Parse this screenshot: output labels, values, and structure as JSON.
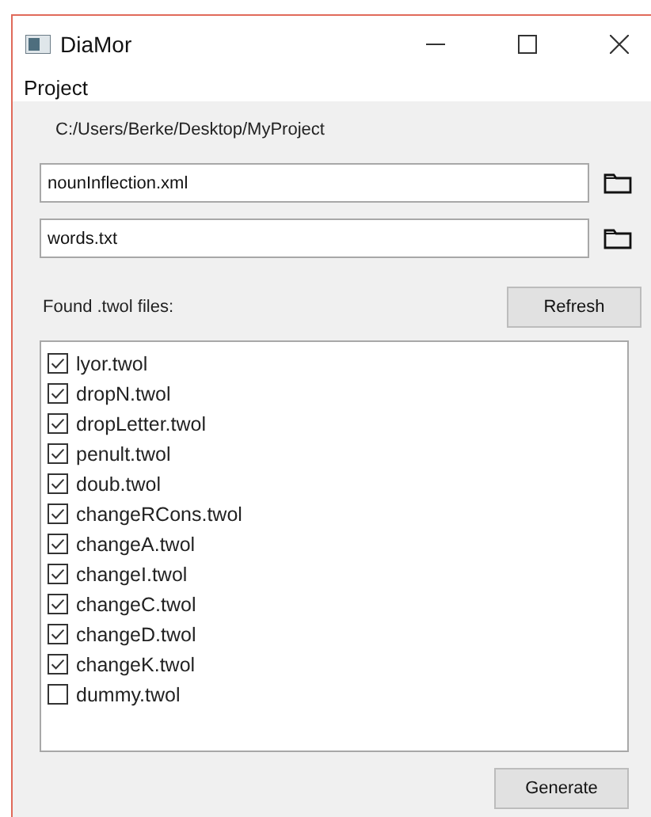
{
  "window": {
    "title": "DiaMor"
  },
  "menu": [
    "Project"
  ],
  "project_path": "C:/Users/Berke/Desktop/MyProject",
  "fields": [
    {
      "value": "nounInflection.xml"
    },
    {
      "value": "words.txt"
    }
  ],
  "found_label": "Found .twol files:",
  "refresh_button": "Refresh",
  "files": [
    {
      "label": "lyor.twol",
      "checked": true
    },
    {
      "label": "dropN.twol",
      "checked": true
    },
    {
      "label": "dropLetter.twol",
      "checked": true
    },
    {
      "label": "penult.twol",
      "checked": true
    },
    {
      "label": "doub.twol",
      "checked": true
    },
    {
      "label": "changeRCons.twol",
      "checked": true
    },
    {
      "label": "changeA.twol",
      "checked": true
    },
    {
      "label": "changeI.twol",
      "checked": true
    },
    {
      "label": "changeC.twol",
      "checked": true
    },
    {
      "label": "changeD.twol",
      "checked": true
    },
    {
      "label": "changeK.twol",
      "checked": true
    },
    {
      "label": "dummy.twol",
      "checked": false
    }
  ],
  "generate_button": "Generate"
}
